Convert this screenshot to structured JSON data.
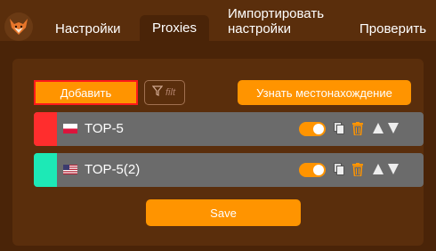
{
  "tabs": [
    {
      "label": "Настройки"
    },
    {
      "label": "Proxies"
    },
    {
      "label": "Импортировать настройки"
    },
    {
      "label": "Проверить"
    }
  ],
  "toolbar": {
    "add_label": "Добавить",
    "filter_placeholder": "filt",
    "locate_label": "Узнать местонахождение"
  },
  "proxies": [
    {
      "name": "TOP-5",
      "color": "#ff2d2d",
      "flag": "poland-flag",
      "enabled": true
    },
    {
      "name": "TOP-5(2)",
      "color": "#1de9b6",
      "flag": "usa-flag",
      "enabled": true
    }
  ],
  "save_label": "Save",
  "colors": {
    "accent": "#ff9400",
    "background": "#5a2e0c",
    "panel": "#4a2408",
    "row": "#6b6b6b"
  }
}
